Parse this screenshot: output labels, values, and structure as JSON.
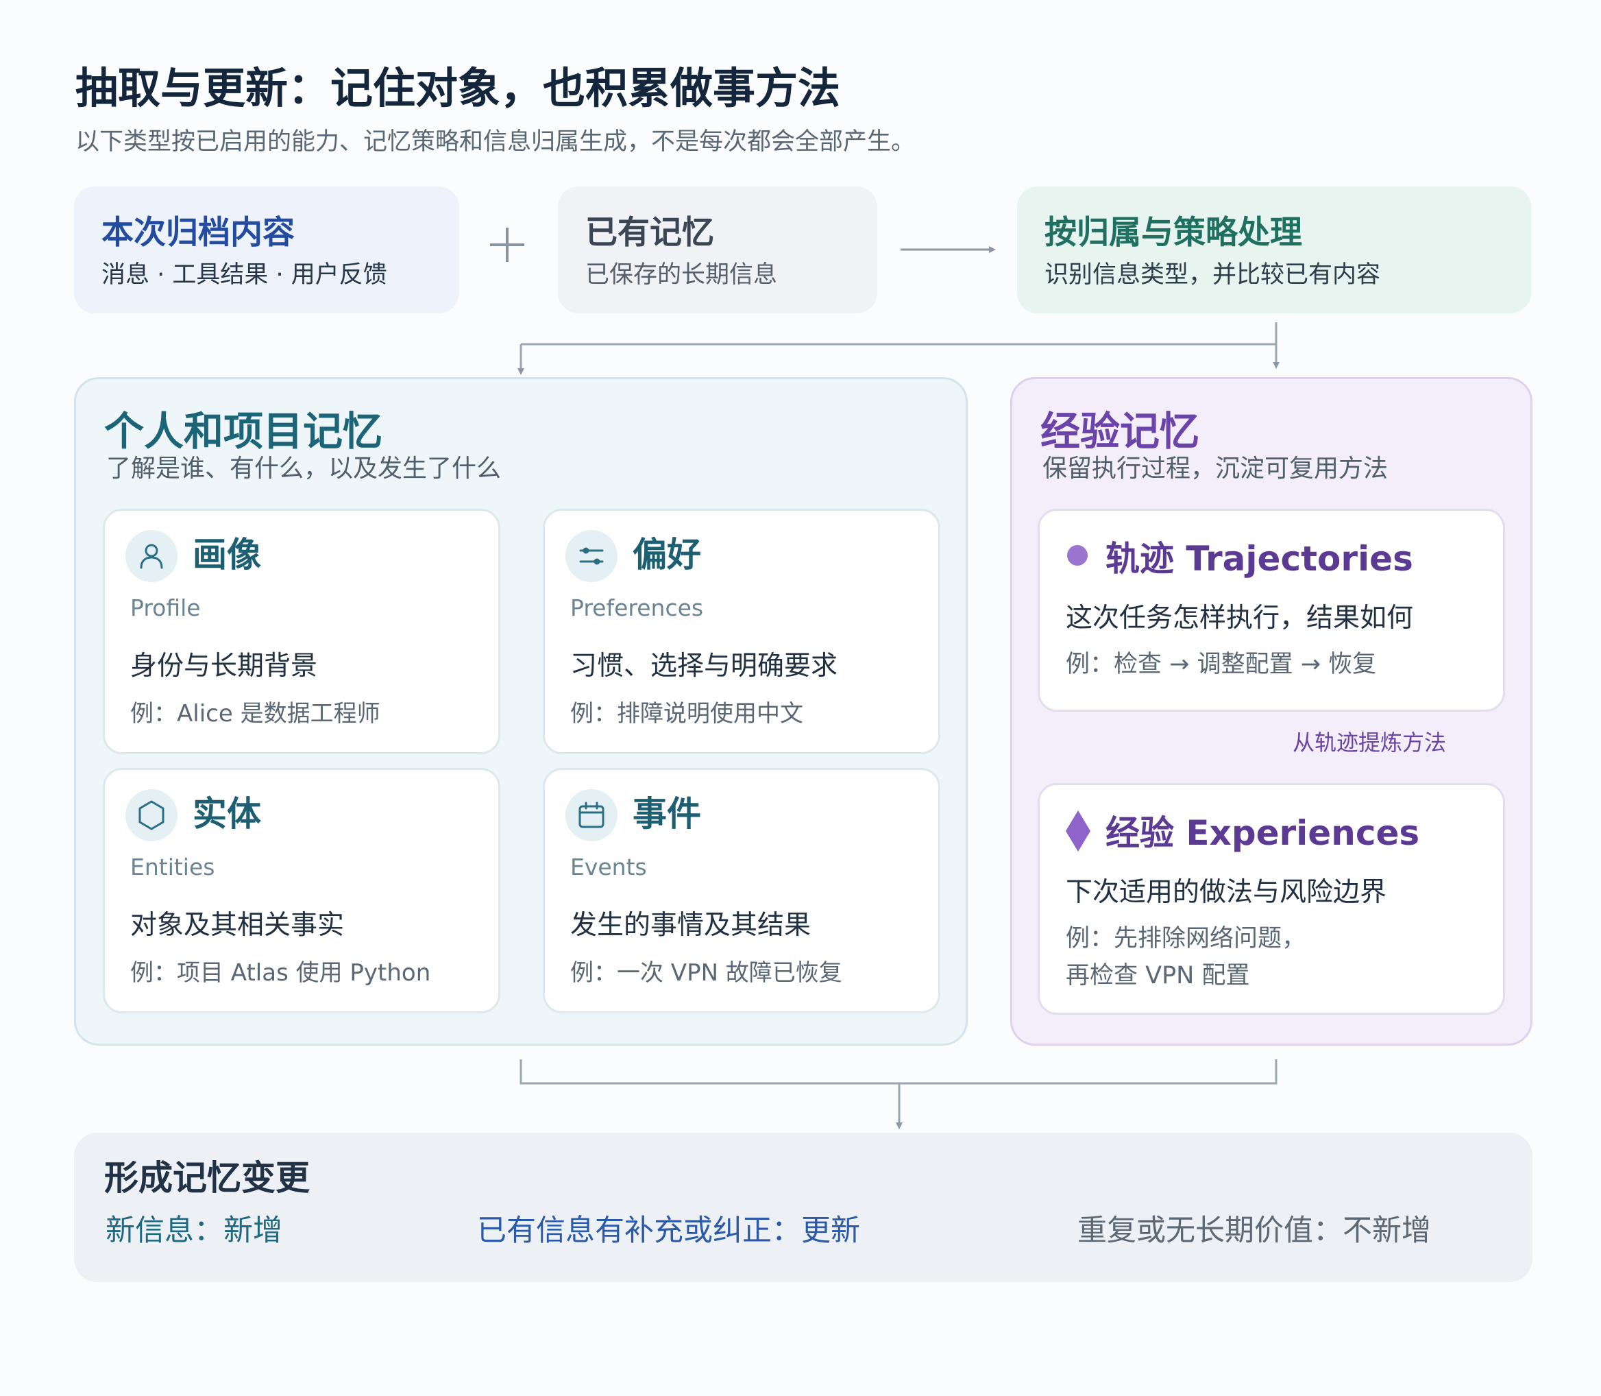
{
  "title": "抽取与更新：记住对象，也积累做事方法",
  "subtitle": "以下类型按已启用的能力、记忆策略和信息归属生成，不是每次都会全部产生。",
  "inputs": {
    "archive": {
      "title": "本次归档内容",
      "items": "消息 · 工具结果 · 用户反馈"
    },
    "existing": {
      "title": "已有记忆",
      "desc": "已保存的长期信息"
    },
    "process": {
      "title": "按归属与策略处理",
      "desc": "识别信息类型，并比较已有内容"
    }
  },
  "personal": {
    "title": "个人和项目记忆",
    "subtitle": "了解是谁、有什么，以及发生了什么",
    "cards": [
      {
        "title": "画像",
        "en": "Profile",
        "desc": "身份与长期背景",
        "example": "例：Alice 是数据工程师",
        "icon": "user-icon"
      },
      {
        "title": "偏好",
        "en": "Preferences",
        "desc": "习惯、选择与明确要求",
        "example": "例：排障说明使用中文",
        "icon": "sliders-icon"
      },
      {
        "title": "实体",
        "en": "Entities",
        "desc": "对象及其相关事实",
        "example": "例：项目 Atlas 使用 Python",
        "icon": "hexagon-icon"
      },
      {
        "title": "事件",
        "en": "Events",
        "desc": "发生的事情及其结果",
        "example": "例：一次 VPN 故障已恢复",
        "icon": "calendar-icon"
      }
    ]
  },
  "experience": {
    "title": "经验记忆",
    "subtitle": "保留执行过程，沉淀可复用方法",
    "trajectories": {
      "title": "轨迹 Trajectories",
      "desc": "这次任务怎样执行，结果如何",
      "example": "例：检查 → 调整配置 → 恢复"
    },
    "distill_label": "从轨迹提炼方法",
    "experiences": {
      "title": "经验 Experiences",
      "desc": "下次适用的做法与风险边界",
      "example_line1": "例：先排除网络问题，",
      "example_line2": "再检查 VPN 配置"
    }
  },
  "changes": {
    "title": "形成记忆变更",
    "add": "新信息：新增",
    "update": "已有信息有补充或纠正：更新",
    "skip": "重复或无长期价值：不新增"
  },
  "colors": {
    "personal_accent": "#1c6478",
    "experience_accent": "#6a44a8",
    "archive_accent": "#234ba0",
    "process_accent": "#1f7060",
    "connector": "#9aa6b4"
  }
}
